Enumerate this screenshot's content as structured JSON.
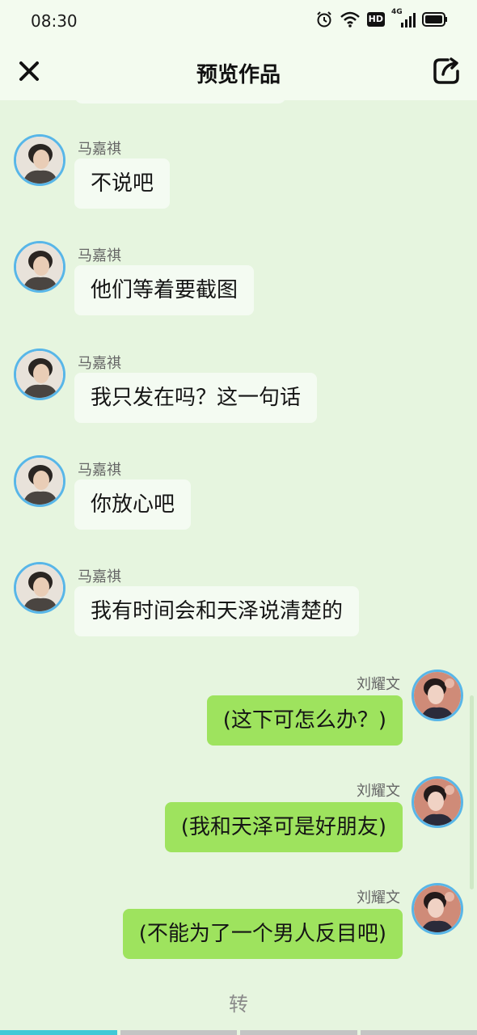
{
  "status_bar": {
    "time": "08:30",
    "network_badge": "HD",
    "network_type": "4G"
  },
  "header": {
    "title": "预览作品"
  },
  "messages": [
    {
      "side": "left",
      "name": "马嘉祺",
      "text": "不说吧"
    },
    {
      "side": "left",
      "name": "马嘉祺",
      "text": "他们等着要截图"
    },
    {
      "side": "left",
      "name": "马嘉祺",
      "text": "我只发在吗？这一句话"
    },
    {
      "side": "left",
      "name": "马嘉祺",
      "text": "你放心吧"
    },
    {
      "side": "left",
      "name": "马嘉祺",
      "text": "我有时间会和天泽说清楚的"
    },
    {
      "side": "right",
      "name": "刘耀文",
      "text": "(这下可怎么办？)"
    },
    {
      "side": "right",
      "name": "刘耀文",
      "text": "(我和天泽可是好朋友)"
    },
    {
      "side": "right",
      "name": "刘耀文",
      "text": "(不能为了一个男人反目吧)"
    }
  ],
  "footer": {
    "action_text": "转"
  },
  "progress": {
    "total_segments": 4,
    "current_segment": 1
  },
  "icons": {
    "close": "close-icon",
    "share": "share-icon",
    "alarm": "alarm-icon",
    "wifi": "wifi-icon",
    "signal": "signal-icon",
    "battery": "battery-icon"
  },
  "colors": {
    "left_bubble": "#f4fbf2",
    "right_bubble": "#9ee35e",
    "avatar_ring": "#58b6e8",
    "background": "#e6f5df",
    "progress_active": "#41c9d7"
  }
}
